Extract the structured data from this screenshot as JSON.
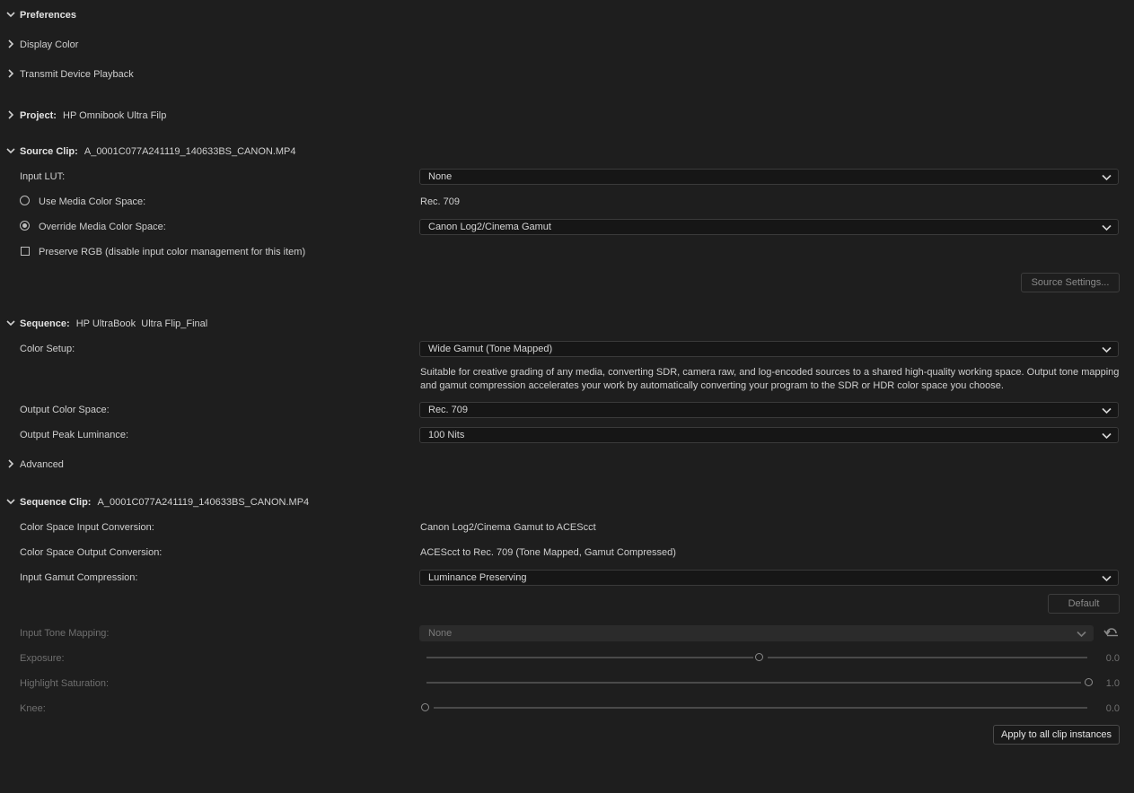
{
  "preferences": {
    "title": "Preferences"
  },
  "display_color": {
    "title": "Display Color"
  },
  "transmit": {
    "title": "Transmit Device Playback"
  },
  "project": {
    "title": "Project:",
    "value": "HP Omnibook Ultra Filp"
  },
  "source_clip": {
    "title": "Source Clip:",
    "value": "A_0001C077A241119_140633BS_CANON.MP4",
    "input_lut_label": "Input LUT:",
    "input_lut_value": "None",
    "use_media_label": "Use Media Color Space:",
    "use_media_value": "Rec. 709",
    "override_label": "Override Media Color Space:",
    "override_value": "Canon Log2/Cinema Gamut",
    "preserve_label": "Preserve RGB (disable input color management for this item)",
    "source_settings_button": "Source Settings..."
  },
  "sequence": {
    "title": "Sequence:",
    "value": "HP UltraBook  Ultra Flip_Final",
    "color_setup_label": "Color Setup:",
    "color_setup_value": "Wide Gamut (Tone Mapped)",
    "description": "Suitable for creative grading of any media, converting SDR, camera raw, and log-encoded sources to a shared high-quality working space. Output tone mapping and gamut compression accelerates your work by automatically converting your program to the SDR or HDR color space you choose.",
    "output_cs_label": "Output Color Space:",
    "output_cs_value": "Rec. 709",
    "peak_lum_label": "Output Peak Luminance:",
    "peak_lum_value": "100 Nits",
    "advanced_label": "Advanced"
  },
  "sequence_clip": {
    "title": "Sequence Clip:",
    "value": "A_0001C077A241119_140633BS_CANON.MP4",
    "input_conv_label": "Color Space Input Conversion:",
    "input_conv_value": "Canon Log2/Cinema Gamut to ACEScct",
    "output_conv_label": "Color Space Output Conversion:",
    "output_conv_value": "ACEScct to Rec. 709 (Tone Mapped, Gamut Compressed)",
    "gamut_comp_label": "Input Gamut Compression:",
    "gamut_comp_value": "Luminance Preserving",
    "default_button": "Default",
    "tone_map_label": "Input Tone Mapping:",
    "tone_map_value": "None",
    "exposure_label": "Exposure:",
    "exposure_value": "0.0",
    "exposure_level": 0.5,
    "highlight_label": "Highlight Saturation:",
    "highlight_value": "1.0",
    "highlight_level": 1.0,
    "knee_label": "Knee:",
    "knee_value": "0.0",
    "knee_level": 0.0,
    "apply_button": "Apply to all clip instances"
  },
  "icons": {
    "chevron_down": "chevron-down-icon",
    "chevron_right": "chevron-right-icon",
    "reset": "reset-icon"
  }
}
